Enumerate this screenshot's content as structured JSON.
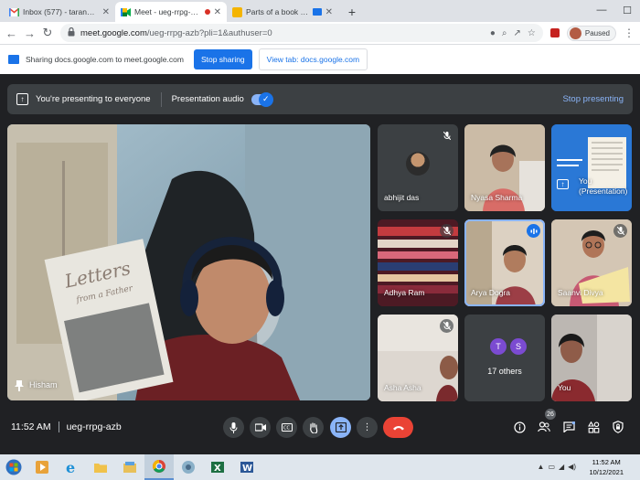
{
  "browser": {
    "tabs": [
      {
        "title": "Inbox (577) - tarannum@theindi",
        "favicon": "gmail-icon",
        "active": false
      },
      {
        "title": "Meet - ueg-rrpg-azb",
        "favicon": "meet-icon",
        "active": true
      },
      {
        "title": "Parts of a book - Google Slid",
        "favicon": "slides-icon",
        "active": false
      }
    ],
    "url_host": "meet.google.com",
    "url_path": "/ueg-rrpg-azb?pli=1&authuser=0",
    "profile_label": "Paused"
  },
  "sharebar": {
    "message": "Sharing docs.google.com to meet.google.com",
    "stop_label": "Stop sharing",
    "view_label": "View tab: docs.google.com"
  },
  "banner": {
    "presenting_text": "You're presenting to everyone",
    "audio_label": "Presentation audio",
    "stop_label": "Stop presenting"
  },
  "main_tile": {
    "name": "Hisham"
  },
  "tiles": [
    {
      "name": "abhijit das",
      "muted": true
    },
    {
      "name": "Nyasa Sharma",
      "muted": false
    },
    {
      "name": "You (Presentation)",
      "muted": false
    },
    {
      "name": "Adhya Ram",
      "muted": true
    },
    {
      "name": "Arya Dogra",
      "speaking": true
    },
    {
      "name": "Saanvi Divya",
      "muted": true
    },
    {
      "name": "Asha Asha",
      "muted": true
    },
    {
      "name": "17 others",
      "initials": [
        "T",
        "S"
      ]
    },
    {
      "name": "You",
      "muted": false
    }
  ],
  "controls": {
    "time": "11:52 AM",
    "meeting_code": "ueg-rrpg-azb",
    "participants_count": "26"
  },
  "taskbar": {
    "time": "11:52 AM",
    "date": "10/12/2021"
  },
  "colors": {
    "meet_bg": "#202124",
    "accent_blue": "#1a73e8",
    "light_blue": "#8ab4f8",
    "end_call_red": "#ea4335"
  }
}
